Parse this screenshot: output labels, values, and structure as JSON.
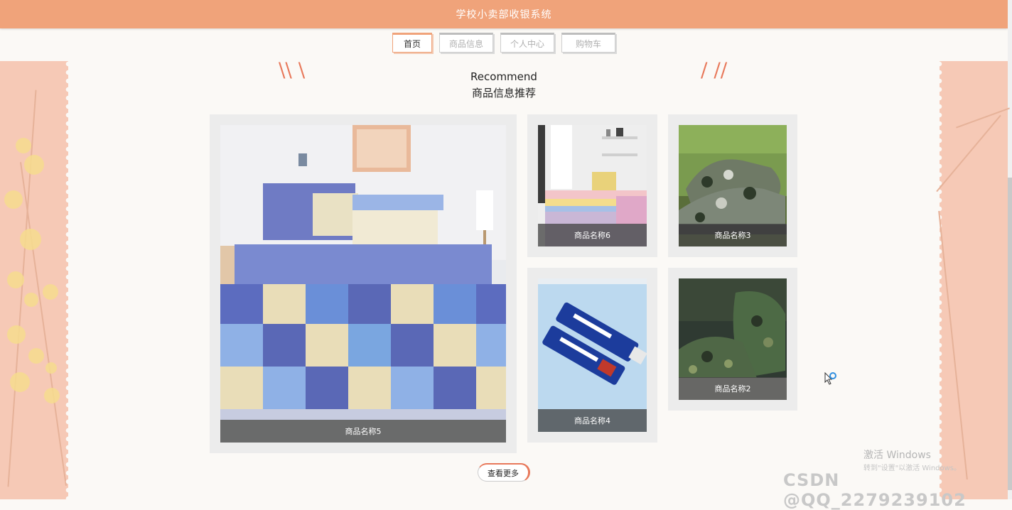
{
  "header": {
    "title": "学校小卖部收银系统"
  },
  "nav": {
    "tabs": [
      {
        "label": "首页",
        "active": true
      },
      {
        "label": "商品信息",
        "active": false
      },
      {
        "label": "个人中心",
        "active": false
      },
      {
        "label": "购物车",
        "active": false
      }
    ]
  },
  "section": {
    "title_en": "Recommend",
    "title_cn": "商品信息推荐"
  },
  "products": [
    {
      "name": "商品名称5",
      "image": "bedding-set-icon"
    },
    {
      "name": "商品名称6",
      "image": "bedroom-icon"
    },
    {
      "name": "商品名称3",
      "image": "camo-shoes-icon"
    },
    {
      "name": "商品名称4",
      "image": "toothpaste-icon"
    },
    {
      "name": "商品名称2",
      "image": "camo-sneakers-icon"
    }
  ],
  "more_button": "查看更多",
  "watermark": {
    "line1": "激活 Windows",
    "line2": "转到\"设置\"以激活 Windows。",
    "line3": "CSDN @QQ_2279239102"
  },
  "colors": {
    "accent": "#f0a37a",
    "quote": "#e8785a",
    "side": "#f6c9b6"
  }
}
